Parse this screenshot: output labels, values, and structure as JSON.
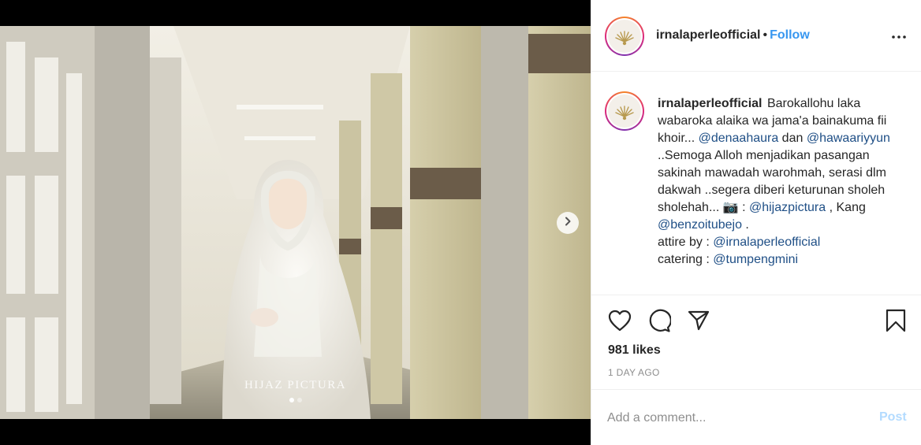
{
  "media": {
    "watermark": "HIJAZ PICTURA",
    "carousel": {
      "count": 2,
      "active_index": 0
    },
    "next_icon": "chevron-right-icon"
  },
  "header": {
    "username": "irnalaperleofficial",
    "separator": "•",
    "follow_label": "Follow",
    "more_icon": "more-horizontal-icon"
  },
  "caption": {
    "username": "irnalaperleofficial",
    "segments": [
      {
        "type": "text",
        "value": "Barokallohu laka wabaroka alaika wa jama'a bainakuma fii khoir... "
      },
      {
        "type": "mention",
        "value": "@denaahaura"
      },
      {
        "type": "text",
        "value": " dan "
      },
      {
        "type": "mention",
        "value": "@hawaariyyun"
      },
      {
        "type": "text",
        "value": " ..Semoga Alloh menjadikan pasangan sakinah mawadah warohmah, serasi dlm dakwah ..segera diberi keturunan sholeh sholehah... 📷 : "
      },
      {
        "type": "mention",
        "value": "@hijazpictura"
      },
      {
        "type": "text",
        "value": " , Kang "
      },
      {
        "type": "mention",
        "value": "@benzoitubejo"
      },
      {
        "type": "text",
        "value": " ."
      },
      {
        "type": "break"
      },
      {
        "type": "text",
        "value": "attire by : "
      },
      {
        "type": "mention",
        "value": "@irnalaperleofficial"
      },
      {
        "type": "break"
      },
      {
        "type": "text",
        "value": "catering : "
      },
      {
        "type": "mention",
        "value": "@tumpengmini"
      }
    ]
  },
  "actions": {
    "like_icon": "heart-icon",
    "comment_icon": "comment-icon",
    "share_icon": "share-icon",
    "save_icon": "bookmark-icon"
  },
  "likes": "981 likes",
  "timestamp": "1 DAY AGO",
  "comment": {
    "placeholder": "Add a comment...",
    "value": "",
    "post_label": "Post"
  },
  "colors": {
    "link_blue": "#3897f0",
    "mention": "#1f4f86",
    "post_disabled": "#b3dbff",
    "muted": "#8e8e8e"
  }
}
